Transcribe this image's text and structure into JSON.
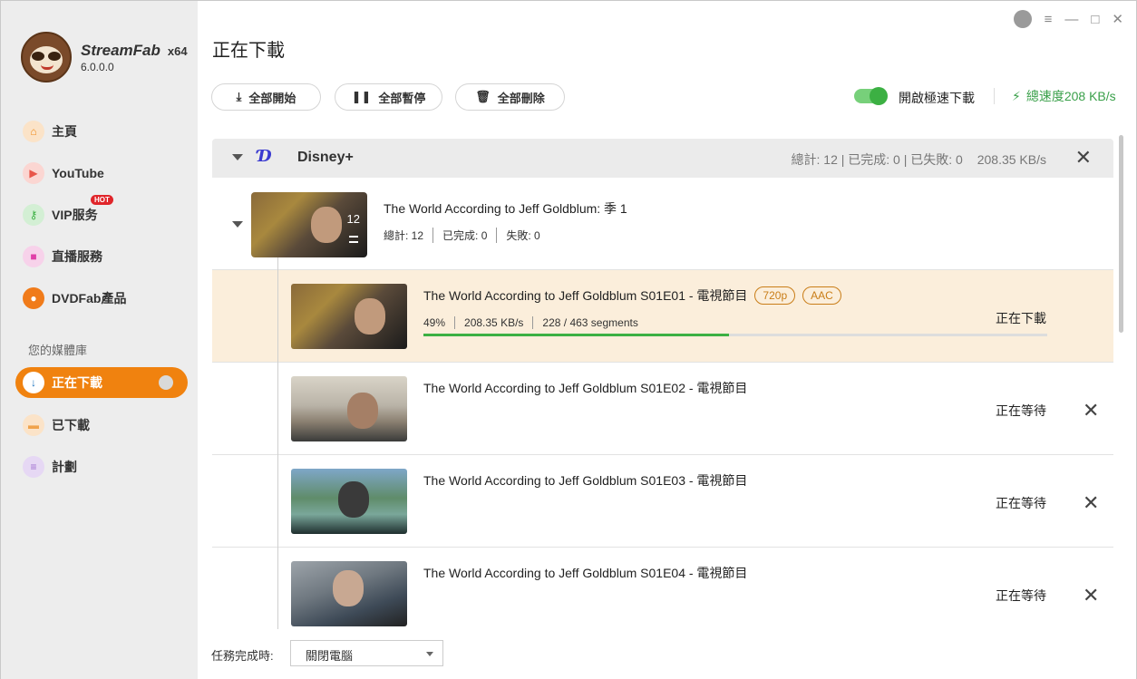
{
  "app": {
    "name": "StreamFab",
    "arch": "x64",
    "version": "6.0.0.0"
  },
  "sidebar": {
    "items": [
      {
        "label": "主頁",
        "icon": "home-icon",
        "color": "#f0a34c"
      },
      {
        "label": "YouTube",
        "icon": "youtube-icon",
        "color": "#e8564a"
      },
      {
        "label": "VIP服务",
        "icon": "key-icon",
        "color": "#3cb043",
        "badge": "HOT"
      },
      {
        "label": "直播服務",
        "icon": "camera-icon",
        "color": "#e040a8"
      },
      {
        "label": "DVDFab產品",
        "icon": "dvdfab-icon",
        "color": "#f07b1a"
      }
    ],
    "library_label": "您的媒體庫",
    "library_items": [
      {
        "label": "正在下載",
        "icon": "download-icon",
        "active": true
      },
      {
        "label": "已下載",
        "icon": "folder-icon",
        "color": "#f0a34c"
      },
      {
        "label": "計劃",
        "icon": "list-icon",
        "color": "#a070d0"
      }
    ]
  },
  "main": {
    "title": "正在下載",
    "toolbar": {
      "start_all": "全部開始",
      "pause_all": "全部暫停",
      "delete_all": "全部刪除",
      "turbo_label": "開啟極速下載",
      "turbo_on": true,
      "total_speed": "總速度208 KB/s"
    },
    "group": {
      "name": "Disney+",
      "stats": "總計: 12 | 已完成: 0 | 已失敗: 0",
      "speed": "208.35 KB/s"
    },
    "season": {
      "title": "The World According to Jeff Goldblum: 季 1",
      "count": "12",
      "total": "總計: 12",
      "done": "已完成: 0",
      "failed": "失敗: 0"
    },
    "episodes": [
      {
        "title": "The World According to Jeff Goldblum S01E01 - 電視節目",
        "tags": [
          "720p",
          "AAC"
        ],
        "percent": "49%",
        "progress": 0.49,
        "speed": "208.35 KB/s",
        "segments": "228 / 463 segments",
        "status": "正在下載"
      },
      {
        "title": "The World According to Jeff Goldblum S01E02 - 電視節目",
        "status": "正在等待"
      },
      {
        "title": "The World According to Jeff Goldblum S01E03 - 電視節目",
        "status": "正在等待"
      },
      {
        "title": "The World According to Jeff Goldblum S01E04 - 電視節目",
        "status": "正在等待"
      }
    ]
  },
  "footer": {
    "label": "任務完成時:",
    "selected": "關閉電腦"
  }
}
